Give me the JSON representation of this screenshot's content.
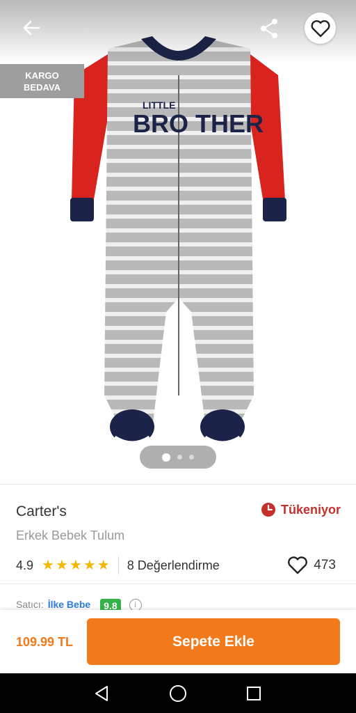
{
  "badge": {
    "line1": "KARGO",
    "line2": "BEDAVA"
  },
  "gallery": {
    "total_pages": 3,
    "active_page": 1,
    "print": {
      "line1": "LITTLE",
      "line2": "BRO THER"
    }
  },
  "product": {
    "brand": "Carter's",
    "stock_status": "Tükeniyor",
    "name": "Erkek Bebek Tulum",
    "rating": "4.9",
    "stars": 5,
    "reviews": "8 Değerlendirme",
    "likes": "473"
  },
  "seller": {
    "label": "Satıcı:",
    "name": "İlke Bebe",
    "score": "9.8"
  },
  "purchase": {
    "price": "109.99 TL",
    "button": "Sepete Ekle"
  },
  "colors": {
    "accent": "#f27a1a",
    "stock_red": "#c4302b",
    "star": "#f5b700",
    "seller_score": "#35b34a",
    "link": "#2a7ae2"
  },
  "icons": {
    "back": "back-arrow-icon",
    "share": "share-icon",
    "favorite": "heart-icon",
    "clock": "clock-icon",
    "info": "info-icon"
  }
}
